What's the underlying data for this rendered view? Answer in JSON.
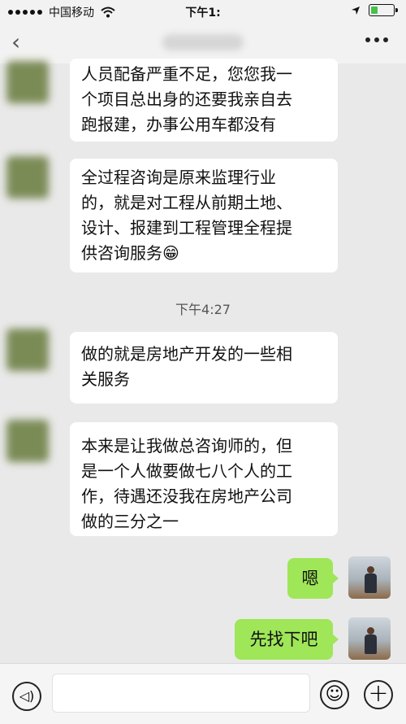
{
  "status_bar": {
    "carrier": "中国移动",
    "time": "下午1:",
    "wifi_icon": "wifi-icon",
    "location_icon": "location-arrow-icon",
    "battery_level": 0.25,
    "battery_color": "#48c14b"
  },
  "nav": {
    "back_icon": "‹",
    "more_icon": "more-dots-icon"
  },
  "messages": [
    {
      "side": "left",
      "lines": [
        "人员配备严重不足，您您我一",
        "个项目总出身的还要我亲自去",
        "跑报建，办事公用车都没有"
      ]
    },
    {
      "side": "left",
      "lines": [
        "全过程咨询是原来监理行业",
        "的，就是对工程从前期土地、",
        "设计、报建到工程管理全程提",
        "供咨询服务"
      ],
      "emoji": "😁"
    },
    {
      "side": "left",
      "lines": [
        "做的就是房地产开发的一些相",
        "关服务"
      ]
    },
    {
      "side": "left",
      "lines": [
        "本来是让我做总咨询师的，但",
        "是一个人做要做七八个人的工",
        "作，待遇还没我在房地产公司",
        "做的三分之一"
      ]
    },
    {
      "side": "right",
      "text": "嗯"
    },
    {
      "side": "right",
      "text": "先找下吧"
    }
  ],
  "time_divider": "下午4:27",
  "colors": {
    "chat_bg": "#e9e9e9",
    "sent_bubble": "#9fe658",
    "received_bubble": "#ffffff"
  },
  "input_bar": {
    "voice_icon": "voice-icon",
    "voice_glyph": "◁)",
    "emoji_icon": "emoji-icon",
    "emoji_glyph": "☺",
    "plus_icon": "plus-icon",
    "plus_glyph": "+"
  }
}
